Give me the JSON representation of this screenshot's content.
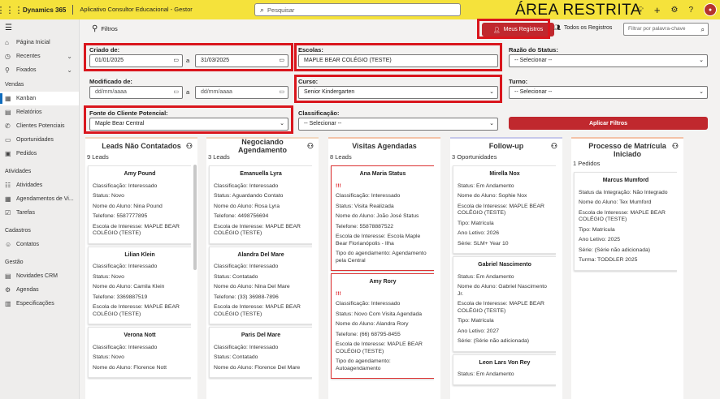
{
  "topbar": {
    "brand": "Dynamics 365",
    "app_title": "Aplicativo Consultor Educacional - Gestor",
    "search_placeholder": "Pesquisar",
    "area": "ÁREA RESTRITA"
  },
  "sidebar": {
    "items": [
      {
        "label": "Página Inicial",
        "icon": "home-icon"
      },
      {
        "label": "Recentes",
        "icon": "clock-icon",
        "chev": "⌄"
      },
      {
        "label": "Fixados",
        "icon": "pin-icon",
        "chev": "⌄"
      }
    ],
    "sections": [
      {
        "title": "Vendas",
        "items": [
          "Kanban",
          "Relatórios",
          "Clientes Potenciais",
          "Oportunidades",
          "Pedidos"
        ]
      },
      {
        "title": "Atividades",
        "items": [
          "Atividades",
          "Agendamentos de Vi...",
          "Tarefas"
        ]
      },
      {
        "title": "Cadastros",
        "items": [
          "Contatos"
        ]
      },
      {
        "title": "Gestão",
        "items": [
          "Novidades CRM",
          "Agendas",
          "Especificações"
        ]
      }
    ]
  },
  "toolbar": {
    "filters_label": "Filtros",
    "meus_registros": "Meus Registros",
    "todos_registros": "Todos os Registros",
    "filter_placeholder": "Filtrar por palavra-chave"
  },
  "filters": {
    "criado_label": "Criado de:",
    "criado_from": "01/01/2025",
    "criado_a": "a",
    "criado_to": "31/03/2025",
    "escolas_label": "Escolas:",
    "escolas_value": "MAPLE BEAR COLÉGIO (TESTE)",
    "razao_label": "Razão do Status:",
    "razao_value": "-- Selecionar --",
    "modificado_label": "Modificado de:",
    "mod_from": "dd/mm/aaaa",
    "mod_a": "a",
    "mod_to": "dd/mm/aaaa",
    "curso_label": "Curso:",
    "curso_value": "Senior Kindergarten",
    "turno_label": "Turno:",
    "turno_value": "-- Selecionar --",
    "fonte_label": "Fonte do Cliente Potencial:",
    "fonte_value": "Maple Bear Central",
    "classif_label": "Classificação:",
    "classif_value": "-- Selecionar --",
    "aplicar": "Aplicar Filtros"
  },
  "columns": [
    {
      "title": "Leads Não Contatados",
      "count": "9 Leads",
      "cards": [
        {
          "name": "Amy Pound",
          "fields": [
            "Classificação: Interessado",
            "Status: Novo",
            "Nome do Aluno: Nina Pound",
            "Telefone: 5587777895",
            "Escola de Interesse: MAPLE BEAR COLÉGIO (TESTE)"
          ]
        },
        {
          "name": "Lilian Klein",
          "fields": [
            "Classificação: Interessado",
            "Status: Novo",
            "Nome do Aluno: Camila Klein",
            "Telefone: 3369887519",
            "Escola de Interesse: MAPLE BEAR COLÉGIO (TESTE)"
          ]
        },
        {
          "name": "Verona Nott",
          "fields": [
            "Classificação: Interessado",
            "Status: Novo",
            "Nome do Aluno: Florence Nott"
          ]
        }
      ]
    },
    {
      "title": "Negociando Agendamento",
      "count": "3 Leads",
      "cards": [
        {
          "name": "Emanuella Lyra",
          "fields": [
            "Classificação: Interessado",
            "Status: Aguardando Contato",
            "Nome do Aluno: Rosa Lyra",
            "Telefone: 4498756694",
            "Escola de Interesse: MAPLE BEAR COLÉGIO (TESTE)"
          ]
        },
        {
          "name": "Alandra Del Mare",
          "fields": [
            "Classificação: Interessado",
            "Status: Contatado",
            "Nome do Aluno: Nina Del Mare",
            "Telefone: (33) 36988-7896",
            "Escola de Interesse: MAPLE BEAR COLÉGIO (TESTE)"
          ]
        },
        {
          "name": "Paris Del Mare",
          "fields": [
            "Classificação: Interessado",
            "Status: Contatado",
            "Nome do Aluno: Florence Del Mare"
          ]
        }
      ]
    },
    {
      "title": "Visitas Agendadas",
      "count": "8 Leads",
      "cards": [
        {
          "name": "Ana Maria Status",
          "excl": "!!!",
          "red": true,
          "fields": [
            "Classificação: Interessado",
            "Status: Visita Realizada",
            "Nome do Aluno: João José Status",
            "Telefone: 55878887522",
            "Escola de Interesse: Escola Maple Bear Florianópolis - Ilha",
            "Tipo do agendamento: Agendamento pela Central"
          ]
        },
        {
          "name": "Amy Rory",
          "excl": "!!!",
          "red": true,
          "fields": [
            "Classificação: Interessado",
            "Status: Novo Com Visita Agendada",
            "Nome do Aluno: Alandra Rory",
            "Telefone: (66) 68795-8455",
            "Escola de Interesse: MAPLE BEAR COLÉGIO (TESTE)",
            "Tipo do agendamento: Autoagendamento"
          ]
        }
      ]
    },
    {
      "title": "Follow-up",
      "count": "3 Oportunidades",
      "cards": [
        {
          "name": "Mirella Nox",
          "fields": [
            "Status: Em Andamento",
            "Nome do Aluno: Sophie Nox",
            "Escola de Interesse: MAPLE BEAR COLÉGIO (TESTE)",
            "Tipo: Matrícula",
            "Ano Letivo: 2026",
            "Série: SLM+ Year 10"
          ]
        },
        {
          "name": "Gabriel Nascimento",
          "fields": [
            "Status: Em Andamento",
            "Nome do Aluno: Gabriel Nascimento Jr.",
            "Escola de Interesse: MAPLE BEAR COLÉGIO (TESTE)",
            "Tipo: Matrícula",
            "Ano Letivo: 2027",
            "Série: (Série não adicionada)"
          ]
        },
        {
          "name": "Leon Lars Von Rey",
          "fields": [
            "Status: Em Andamento"
          ]
        }
      ]
    },
    {
      "title": "Processo de Matrícula Iniciado",
      "count": "1 Pedidos",
      "cards": [
        {
          "name": "Marcus Mumford",
          "fields": [
            "Status da Integração: Não Integrado",
            "Nome do Aluno: Tex Mumford",
            "Escola de Interesse: MAPLE BEAR COLÉGIO (TESTE)",
            "Tipo: Matrícula",
            "Ano Letivo: 2025",
            "Série: (Série não adicionada)",
            "Turma: TODDLER 2025"
          ]
        }
      ]
    }
  ]
}
